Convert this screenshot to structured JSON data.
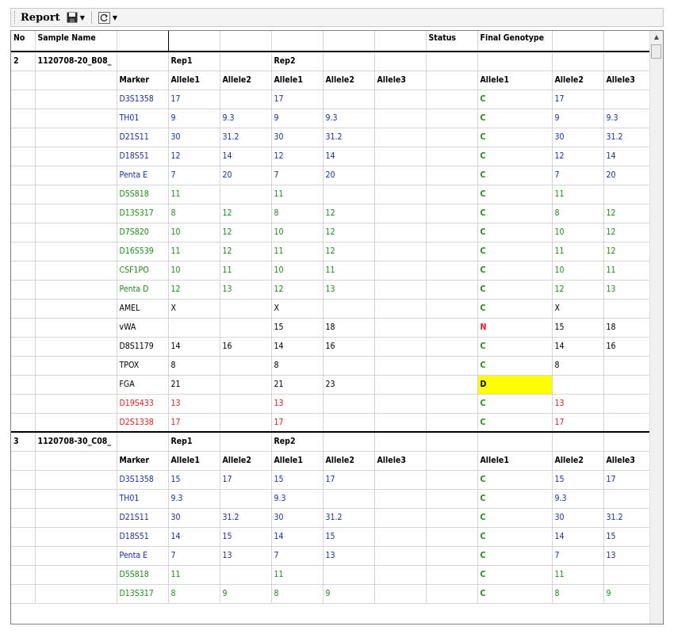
{
  "toolbar": {
    "title": "Report",
    "save_icon": "floppy-disk-icon",
    "refresh_icon": "refresh-icon"
  },
  "header": [
    "No",
    "Sample Name",
    "",
    "",
    "",
    "",
    "",
    "",
    "Status",
    "Final Genotype",
    "",
    ""
  ],
  "samples": [
    {
      "no": "2",
      "name": "1120708-20_B08_",
      "rep1": "Rep1",
      "rep2": "Rep2",
      "subheader": [
        "Marker",
        "Allele1",
        "Allele2",
        "Allele1",
        "Allele2",
        "Allele3",
        "",
        "Allele1",
        "Allele2",
        "Allele3"
      ],
      "rows": [
        {
          "marker": "D3S1358",
          "color": "blue",
          "r1a1": "17",
          "r1a2": "",
          "r2a1": "17",
          "r2a2": "",
          "r2a3": "",
          "status": "C",
          "f1": "17",
          "f2": "",
          "f3": ""
        },
        {
          "marker": "TH01",
          "color": "blue",
          "r1a1": "9",
          "r1a2": "9.3",
          "r2a1": "9",
          "r2a2": "9.3",
          "r2a3": "",
          "status": "C",
          "f1": "9",
          "f2": "9.3",
          "f3": ""
        },
        {
          "marker": "D21S11",
          "color": "blue",
          "r1a1": "30",
          "r1a2": "31.2",
          "r2a1": "30",
          "r2a2": "31.2",
          "r2a3": "",
          "status": "C",
          "f1": "30",
          "f2": "31.2",
          "f3": ""
        },
        {
          "marker": "D18S51",
          "color": "blue",
          "r1a1": "12",
          "r1a2": "14",
          "r2a1": "12",
          "r2a2": "14",
          "r2a3": "",
          "status": "C",
          "f1": "12",
          "f2": "14",
          "f3": ""
        },
        {
          "marker": "Penta E",
          "color": "blue",
          "r1a1": "7",
          "r1a2": "20",
          "r2a1": "7",
          "r2a2": "20",
          "r2a3": "",
          "status": "C",
          "f1": "7",
          "f2": "20",
          "f3": ""
        },
        {
          "marker": "D5S818",
          "color": "green",
          "r1a1": "11",
          "r1a2": "",
          "r2a1": "11",
          "r2a2": "",
          "r2a3": "",
          "status": "C",
          "f1": "11",
          "f2": "",
          "f3": ""
        },
        {
          "marker": "D13S317",
          "color": "green",
          "r1a1": "8",
          "r1a2": "12",
          "r2a1": "8",
          "r2a2": "12",
          "r2a3": "",
          "status": "C",
          "f1": "8",
          "f2": "12",
          "f3": ""
        },
        {
          "marker": "D7S820",
          "color": "green",
          "r1a1": "10",
          "r1a2": "12",
          "r2a1": "10",
          "r2a2": "12",
          "r2a3": "",
          "status": "C",
          "f1": "10",
          "f2": "12",
          "f3": ""
        },
        {
          "marker": "D16S539",
          "color": "green",
          "r1a1": "11",
          "r1a2": "12",
          "r2a1": "11",
          "r2a2": "12",
          "r2a3": "",
          "status": "C",
          "f1": "11",
          "f2": "12",
          "f3": ""
        },
        {
          "marker": "CSF1PO",
          "color": "green",
          "r1a1": "10",
          "r1a2": "11",
          "r2a1": "10",
          "r2a2": "11",
          "r2a3": "",
          "status": "C",
          "f1": "10",
          "f2": "11",
          "f3": ""
        },
        {
          "marker": "Penta D",
          "color": "green",
          "r1a1": "12",
          "r1a2": "13",
          "r2a1": "12",
          "r2a2": "13",
          "r2a3": "",
          "status": "C",
          "f1": "12",
          "f2": "13",
          "f3": ""
        },
        {
          "marker": "AMEL",
          "color": "black",
          "r1a1": "X",
          "r1a2": "",
          "r2a1": "X",
          "r2a2": "",
          "r2a3": "",
          "status": "C",
          "f1": "X",
          "f2": "",
          "f3": ""
        },
        {
          "marker": "vWA",
          "color": "black",
          "r1a1": "",
          "r1a2": "",
          "r2a1": "15",
          "r2a2": "18",
          "r2a3": "",
          "status": "N",
          "f1": "15",
          "f2": "18",
          "f3": ""
        },
        {
          "marker": "D8S1179",
          "color": "black",
          "r1a1": "14",
          "r1a2": "16",
          "r2a1": "14",
          "r2a2": "16",
          "r2a3": "",
          "status": "C",
          "f1": "14",
          "f2": "16",
          "f3": ""
        },
        {
          "marker": "TPOX",
          "color": "black",
          "r1a1": "8",
          "r1a2": "",
          "r2a1": "8",
          "r2a2": "",
          "r2a3": "",
          "status": "C",
          "f1": "8",
          "f2": "",
          "f3": ""
        },
        {
          "marker": "FGA",
          "color": "black",
          "r1a1": "21",
          "r1a2": "",
          "r2a1": "21",
          "r2a2": "23",
          "r2a3": "",
          "status": "D",
          "f1": "",
          "f2": "",
          "f3": ""
        },
        {
          "marker": "D19S433",
          "color": "red",
          "r1a1": "13",
          "r1a2": "",
          "r2a1": "13",
          "r2a2": "",
          "r2a3": "",
          "status": "C",
          "f1": "13",
          "f2": "",
          "f3": ""
        },
        {
          "marker": "D2S1338",
          "color": "red",
          "r1a1": "17",
          "r1a2": "",
          "r2a1": "17",
          "r2a2": "",
          "r2a3": "",
          "status": "C",
          "f1": "17",
          "f2": "",
          "f3": ""
        }
      ]
    },
    {
      "no": "3",
      "name": "1120708-30_C08_",
      "rep1": "Rep1",
      "rep2": "Rep2",
      "subheader": [
        "Marker",
        "Allele1",
        "Allele2",
        "Allele1",
        "Allele2",
        "Allele3",
        "",
        "Allele1",
        "Allele2",
        "Allele3"
      ],
      "rows": [
        {
          "marker": "D3S1358",
          "color": "blue",
          "r1a1": "15",
          "r1a2": "17",
          "r2a1": "15",
          "r2a2": "17",
          "r2a3": "",
          "status": "C",
          "f1": "15",
          "f2": "17",
          "f3": ""
        },
        {
          "marker": "TH01",
          "color": "blue",
          "r1a1": "9.3",
          "r1a2": "",
          "r2a1": "9.3",
          "r2a2": "",
          "r2a3": "",
          "status": "C",
          "f1": "9.3",
          "f2": "",
          "f3": ""
        },
        {
          "marker": "D21S11",
          "color": "blue",
          "r1a1": "30",
          "r1a2": "31.2",
          "r2a1": "30",
          "r2a2": "31.2",
          "r2a3": "",
          "status": "C",
          "f1": "30",
          "f2": "31.2",
          "f3": ""
        },
        {
          "marker": "D18S51",
          "color": "blue",
          "r1a1": "14",
          "r1a2": "15",
          "r2a1": "14",
          "r2a2": "15",
          "r2a3": "",
          "status": "C",
          "f1": "14",
          "f2": "15",
          "f3": ""
        },
        {
          "marker": "Penta E",
          "color": "blue",
          "r1a1": "7",
          "r1a2": "13",
          "r2a1": "7",
          "r2a2": "13",
          "r2a3": "",
          "status": "C",
          "f1": "7",
          "f2": "13",
          "f3": ""
        },
        {
          "marker": "D5S818",
          "color": "green",
          "r1a1": "11",
          "r1a2": "",
          "r2a1": "11",
          "r2a2": "",
          "r2a3": "",
          "status": "C",
          "f1": "11",
          "f2": "",
          "f3": ""
        },
        {
          "marker": "D13S317",
          "color": "green",
          "r1a1": "8",
          "r1a2": "9",
          "r2a1": "8",
          "r2a2": "9",
          "r2a3": "",
          "status": "C",
          "f1": "8",
          "f2": "9",
          "f3": ""
        }
      ]
    }
  ]
}
